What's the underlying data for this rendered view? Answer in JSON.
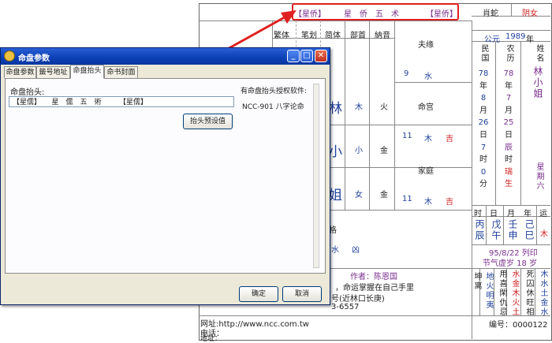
{
  "header": {
    "title_left": "【星侨】",
    "title_mid": "星　侨　五　术",
    "title_right": "【星侨】"
  },
  "grid": {
    "headers": [
      "繁体",
      "笔划",
      "简体",
      "部首",
      "納音"
    ],
    "name_chars": [
      {
        "char": "林",
        "radical": "木",
        "nayin": "火"
      },
      {
        "char": "小",
        "radical": "小",
        "nayin": "金"
      },
      {
        "char": "姐",
        "radical": "女",
        "nayin": "金"
      }
    ],
    "sections": [
      {
        "title": "夫缘",
        "num": "9",
        "element": "水",
        "luck": ""
      },
      {
        "title": "命宫",
        "num": "11",
        "element": "木",
        "luck": "吉"
      },
      {
        "title": "家庭",
        "num": "11",
        "element": "木",
        "luck": "吉"
      }
    ]
  },
  "right_panel": {
    "zodiac": "肖蛇",
    "gender": "阴女",
    "era": "公元",
    "year": "1989",
    "year_unit": "年",
    "col_minguo": "民国",
    "col_nongli": "农历",
    "col_name": "姓名",
    "minguo_vals": [
      "78",
      "年",
      "8",
      "月",
      "26",
      "日",
      "7",
      "时",
      "0",
      "分"
    ],
    "nongli_vals": [
      "78",
      "年",
      "7",
      "月",
      "25",
      "日",
      "辰",
      "时",
      "瑞",
      "生"
    ],
    "name_vert": "林小姐",
    "weekday": "星期六",
    "pillar_headers": [
      "时",
      "日",
      "月",
      "年",
      "运"
    ],
    "pillars": [
      "丙辰",
      "戊午",
      "壬申",
      "己巳"
    ],
    "luck_elem": "木",
    "print_date": "95/8/22 列印",
    "jieqi": "节气虚岁 18 岁"
  },
  "bottom": {
    "format_tail": "格",
    "water": "水",
    "bad": "凶",
    "author": "作者：陈恩国",
    "slogan": "，命运掌握在自己手里",
    "address_frag": "号(近林口长庚)",
    "phone_frag": "3-6557",
    "website": "网址:http://www.ncc.com.tw",
    "tel": "电话：",
    "addr": "地址：",
    "serial": "编号：0000122",
    "trigram1": "坤离",
    "col_a": "地火明夷",
    "col_b": "用喜閑仇忌",
    "col_c": "水金木火土",
    "col_d": "死囚休旺相",
    "col_e": "木水土金水"
  },
  "dialog": {
    "title": "命盘参数",
    "tabs": [
      "命盘参数",
      "籤号地址",
      "命盘抬头",
      "命书封面"
    ],
    "field_label": "命盘抬头:",
    "field_value": "【星儒】　　星　儒　五　術　　　【星儒】",
    "preset_button": "抬头预设值",
    "license_label": "有命盘抬头授权软件:",
    "license_item": "NCC-901 八字论命",
    "ok": "确定",
    "cancel": "取消"
  }
}
